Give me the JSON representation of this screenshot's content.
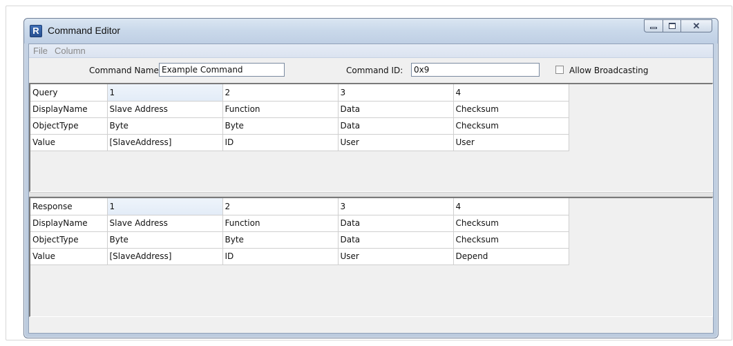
{
  "window": {
    "title": "Command Editor",
    "app_icon_letter": "R"
  },
  "menu": [
    "File",
    "Column"
  ],
  "props": {
    "command_name_label": "Command Name:",
    "command_name_value": "Example Command",
    "command_id_label": "Command ID:",
    "command_id_value": "0x9",
    "allow_broadcasting_label": "Allow Broadcasting",
    "allow_broadcasting_checked": false
  },
  "query_table": {
    "rows": [
      [
        "Query",
        "1",
        "2",
        "3",
        "4"
      ],
      [
        "DisplayName",
        "Slave Address",
        "Function",
        "Data",
        "Checksum"
      ],
      [
        "ObjectType",
        "Byte",
        "Byte",
        "Data",
        "Checksum"
      ],
      [
        "Value",
        "[SlaveAddress]",
        "ID",
        "User",
        "User"
      ]
    ]
  },
  "response_table": {
    "rows": [
      [
        "Response",
        "1",
        "2",
        "3",
        "4"
      ],
      [
        "DisplayName",
        "Slave Address",
        "Function",
        "Data",
        "Checksum"
      ],
      [
        "ObjectType",
        "Byte",
        "Byte",
        "Data",
        "Checksum"
      ],
      [
        "Value",
        "[SlaveAddress]",
        "ID",
        "User",
        "Depend"
      ]
    ]
  },
  "colors": {
    "title_bar": "#c9d8ea",
    "grid_border": "#7a7a7a",
    "cell_border": "#cfcfcf",
    "selected_header_cell": "#e3ecf7"
  }
}
